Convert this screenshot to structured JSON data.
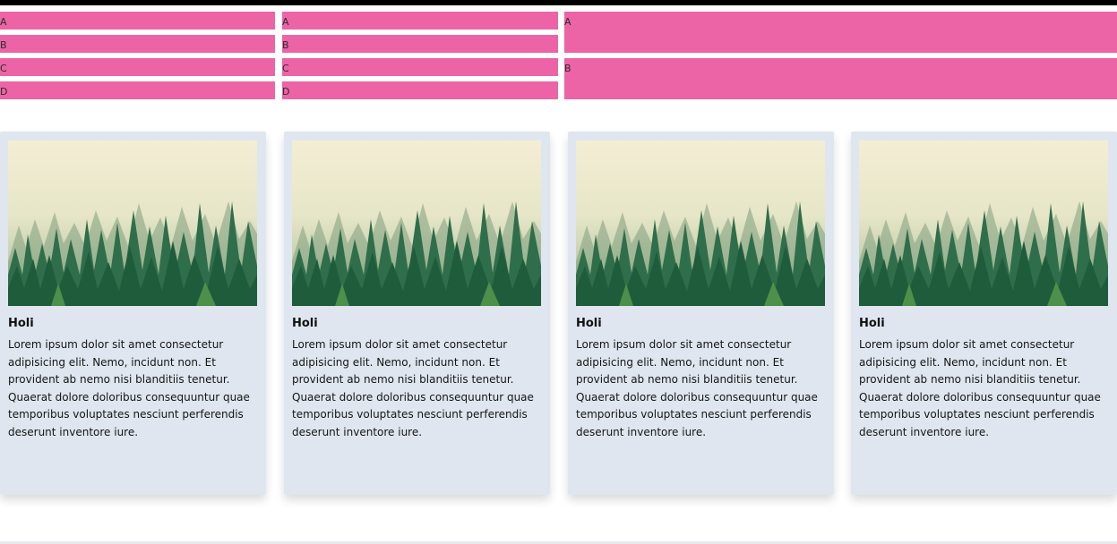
{
  "grid_left": {
    "rows": [
      "A",
      "B",
      "C",
      "D"
    ]
  },
  "grid_middle": {
    "rows": [
      "A",
      "B",
      "C",
      "D"
    ]
  },
  "grid_right": {
    "rows": [
      "A",
      "B"
    ]
  },
  "cards": [
    {
      "title": "Holi",
      "body": "Lorem ipsum dolor sit amet consectetur adipisicing elit. Nemo, incidunt non. Et provident ab nemo nisi blanditiis tenetur. Quaerat dolore doloribus consequuntur quae temporibus voluptates nesciunt perferendis deserunt inventore iure.",
      "image": "misty-forest-image"
    },
    {
      "title": "Holi",
      "body": "Lorem ipsum dolor sit amet consectetur adipisicing elit. Nemo, incidunt non. Et provident ab nemo nisi blanditiis tenetur. Quaerat dolore doloribus consequuntur quae temporibus voluptates nesciunt perferendis deserunt inventore iure.",
      "image": "misty-forest-image"
    },
    {
      "title": "Holi",
      "body": "Lorem ipsum dolor sit amet consectetur adipisicing elit. Nemo, incidunt non. Et provident ab nemo nisi blanditiis tenetur. Quaerat dolore doloribus consequuntur quae temporibus voluptates nesciunt perferendis deserunt inventore iure.",
      "image": "misty-forest-image"
    },
    {
      "title": "Holi",
      "body": "Lorem ipsum dolor sit amet consectetur adipisicing elit. Nemo, incidunt non. Et provident ab nemo nisi blanditiis tenetur. Quaerat dolore doloribus consequuntur quae temporibus voluptates nesciunt perferendis deserunt inventore iure.",
      "image": "misty-forest-image"
    }
  ],
  "colors": {
    "pink": "#ec64a6",
    "card_bg": "#dfe6ef",
    "top_border": "#000000"
  }
}
